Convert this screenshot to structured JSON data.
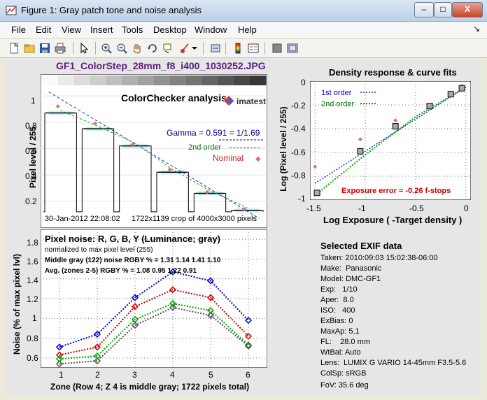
{
  "window": {
    "title": "Figure 1: Gray patch tone and noise analysis",
    "buttons": {
      "minimize": "–",
      "maximize": "□",
      "close": "X"
    }
  },
  "menu": {
    "items": [
      "File",
      "Edit",
      "View",
      "Insert",
      "Tools",
      "Desktop",
      "Window",
      "Help"
    ],
    "arrow": "↘"
  },
  "toolbar": {
    "icons": [
      "new-file-icon",
      "open-folder-icon",
      "save-icon",
      "print-icon",
      "pointer-icon",
      "zoom-in-icon",
      "zoom-out-icon",
      "pan-hand-icon",
      "rotate-icon",
      "data-cursor-icon",
      "brush-icon",
      "link-icon",
      "colorbar-icon",
      "legend-icon",
      "hide-plot-tools-icon",
      "show-plot-tools-icon"
    ]
  },
  "figure": {
    "file_title": "GF1_ColorStep_28mm_f8_i400_1030252.JPG"
  },
  "tone_plot": {
    "inner_title": "ColorChecker analysis",
    "logo_text": "imatest",
    "gamma_label": "Gamma = 0.591 = 1/1.69",
    "second_order_label": "2nd order",
    "nominal_label": "Nominal",
    "ylabel": "Pixel level / 255",
    "date_label": "30-Jan-2012 22:08:02",
    "crop_label": "1722x1139 crop of 4000x3000 pixels",
    "yticks": [
      "1",
      "0.8",
      "0.6",
      "0.4",
      "0.2"
    ]
  },
  "density_plot": {
    "title": "Density response & curve fits",
    "ylabel": "Log (Pixel level / 255)",
    "xlabel": "Log Exposure ( -Target density )",
    "legend": [
      "1st order",
      "2nd order"
    ],
    "exposure_error": "Exposure error = -0.26 f-stops",
    "yticks": [
      "0",
      "-0.2",
      "-0.4",
      "-0.6",
      "-0.8",
      "-1"
    ],
    "xticks": [
      "-1.5",
      "-1",
      "-0.5",
      "0"
    ]
  },
  "noise_plot": {
    "title": "Pixel noise: R, G, B, Y (Luminance; gray)",
    "subtitle": "normalized to max pixel level (255)",
    "line1": "Middle gray (122) noise RGBY % = 1.31  1.14  1.41  1.10",
    "line2": "Avg. (zones 2-5) RGBY % = 1.08  0.95  1.22  0.91",
    "ylabel": "Noise (% of max pixel lvl)",
    "xlabel": "Zone  (Row 4;  Z 4 is middle gray;  1722 pixels total)",
    "yticks": [
      "1.8",
      "1.6",
      "1.4",
      "1.2",
      "1",
      "0.8",
      "0.6"
    ],
    "xticks": [
      "1",
      "2",
      "3",
      "4",
      "5",
      "6"
    ]
  },
  "exif": {
    "title": "Selected EXIF data",
    "lines": [
      "Taken: 2010:09:03 15:02:38-06:00",
      "Make:  Panasonic",
      "Model: DMC-GF1",
      "Exp:   1/10",
      "Aper:  8.0",
      "ISO:   400",
      "ExBias: 0",
      "MaxAp: 5.1",
      "FL:    28.0 mm",
      "WtBal: Auto",
      "Lens:  LUMIX G VARIO 14-45mm F3.5-5.6",
      "ColSp: sRGB"
    ],
    "fov": "FoV:   35.6 deg"
  },
  "chart_data": [
    {
      "type": "line",
      "title": "ColorChecker analysis",
      "ylabel": "Pixel level / 255",
      "ylim": [
        0.05,
        1.08
      ],
      "steps": [
        0.87,
        0.75,
        0.62,
        0.42,
        0.26,
        0.13
      ],
      "series": [
        {
          "name": "Gamma = 0.591 = 1/1.69",
          "points": [
            [
              0.03,
              1.03
            ],
            [
              0.97,
              0.07
            ]
          ]
        },
        {
          "name": "Nominal",
          "values": [
            0.92,
            0.79,
            0.63,
            0.44,
            0.27,
            0.14
          ]
        }
      ]
    },
    {
      "type": "line",
      "title": "Density response & curve fits",
      "xlabel": "Log Exposure ( -Target density )",
      "ylabel": "Log (Pixel level / 255)",
      "xlim": [
        -1.55,
        0.05
      ],
      "ylim": [
        -1.0,
        0.0
      ],
      "series": [
        {
          "name": "1st order",
          "x": [
            -1.5,
            0.0
          ],
          "y": [
            -0.86,
            -0.05
          ]
        },
        {
          "name": "2nd order",
          "x": [
            -1.5,
            -1.0,
            -0.5,
            0.0
          ],
          "y": [
            -0.96,
            -0.62,
            -0.3,
            -0.05
          ]
        },
        {
          "name": "measured",
          "x": [
            -1.48,
            -1.05,
            -0.7,
            -0.36,
            -0.15,
            -0.04
          ],
          "y": [
            -0.94,
            -0.59,
            -0.38,
            -0.21,
            -0.11,
            -0.06
          ]
        },
        {
          "name": "nominal",
          "x": [
            -1.5,
            -1.05,
            -0.7,
            -0.36,
            -0.15,
            -0.04
          ],
          "y": [
            -0.72,
            -0.49,
            -0.33,
            -0.2,
            -0.11,
            -0.04
          ]
        }
      ]
    },
    {
      "type": "line",
      "title": "Pixel noise: R, G, B, Y (Luminance; gray)",
      "xlabel": "Zone  (Row 4;  Z 4 is middle gray;  1722 pixels total)",
      "ylabel": "Noise (% of max pixel lvl)",
      "xlim": [
        0.5,
        6.5
      ],
      "ylim": [
        0.5,
        1.9
      ],
      "categories": [
        1,
        2,
        3,
        4,
        5,
        6
      ],
      "series": [
        {
          "color": "#0000cc",
          "values": [
            0.71,
            0.84,
            1.21,
            1.47,
            1.38,
            0.98
          ]
        },
        {
          "color": "#cc0000",
          "values": [
            0.63,
            0.71,
            1.12,
            1.29,
            1.21,
            0.82
          ]
        },
        {
          "color": "#00aa00",
          "values": [
            0.59,
            0.62,
            0.99,
            1.15,
            1.08,
            0.73
          ]
        },
        {
          "color": "#555555",
          "values": [
            0.54,
            0.57,
            0.93,
            1.11,
            1.03,
            0.72
          ]
        }
      ]
    }
  ]
}
